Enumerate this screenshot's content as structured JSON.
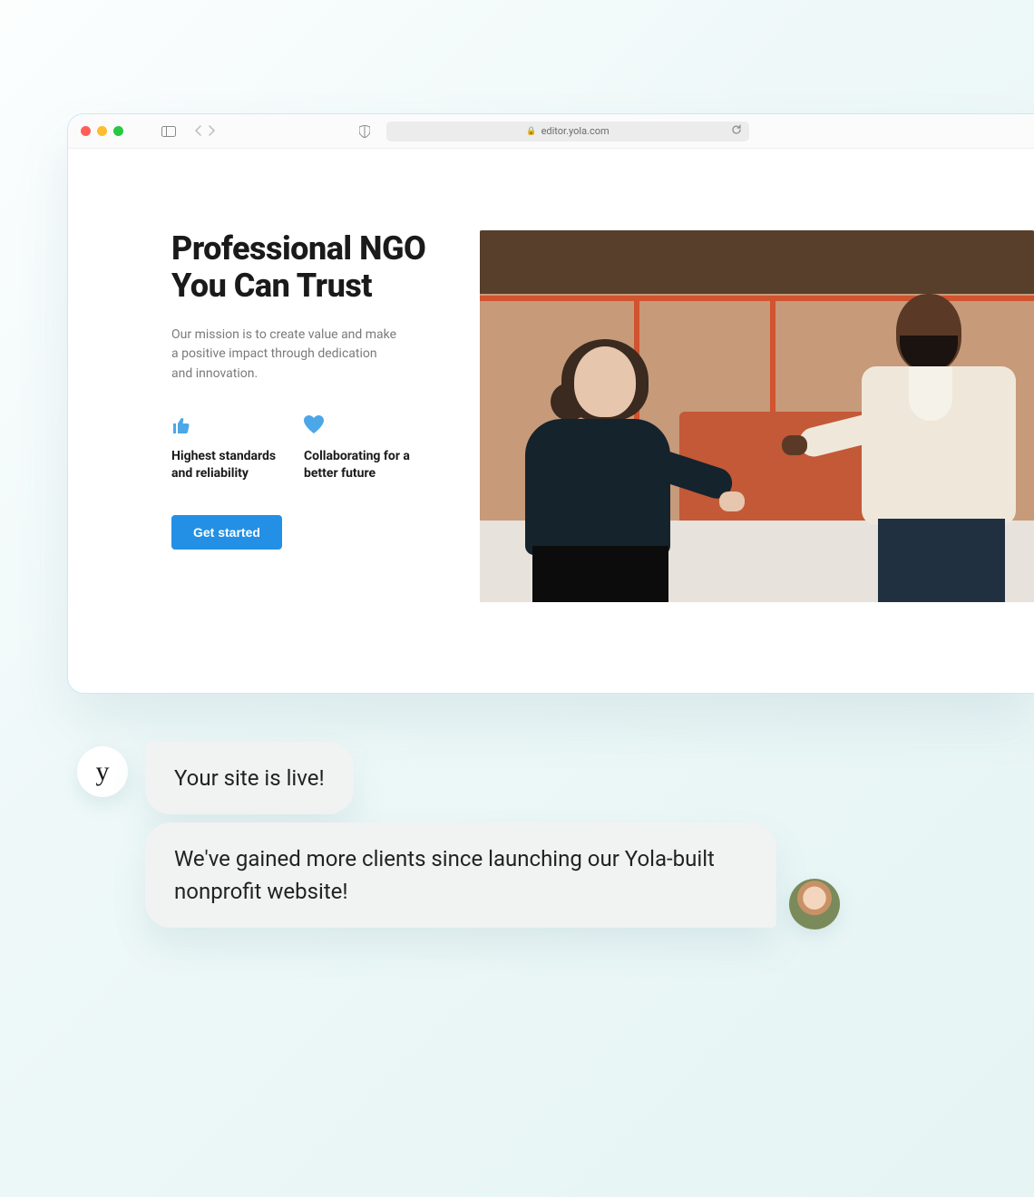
{
  "browser": {
    "url": "editor.yola.com"
  },
  "hero": {
    "heading": "Professional NGO You Can Trust",
    "subtext": "Our mission is to create value and make a positive impact through dedication and innovation.",
    "features": [
      {
        "label": "Highest standards and reliability",
        "icon": "thumbs-up-icon"
      },
      {
        "label": "Collaborating for a better future",
        "icon": "heart-icon"
      }
    ],
    "cta_label": "Get started",
    "image_alt": "Two people shaking hands in a modern office"
  },
  "chat": {
    "brand_initial": "y",
    "message_system": "Your site is live!",
    "message_user": "We've gained more clients since launching our Yola-built nonprofit website!"
  }
}
